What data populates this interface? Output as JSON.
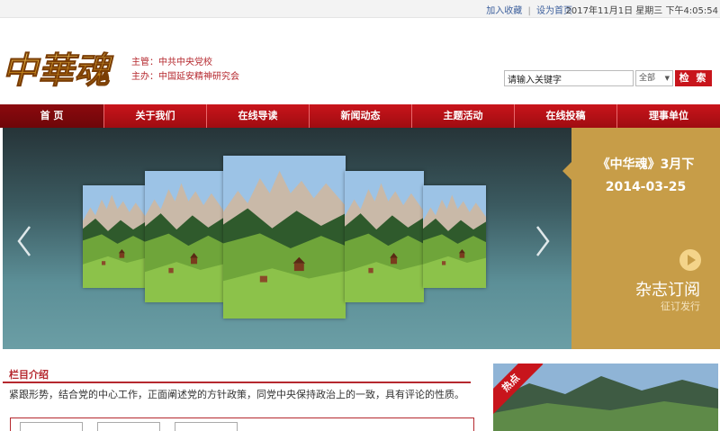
{
  "topbar": {
    "add_favorite": "加入收藏",
    "separator": "|",
    "set_homepage": "设为首页",
    "datetime": "2017年11月1日 星期三 下午4:05:54"
  },
  "header": {
    "logo_text": "中華魂",
    "supervisor": "主管：中共中央党校",
    "organizer": "主办：中国延安精神研究会",
    "search": {
      "value": "请输入关键字",
      "scope": "全部",
      "button": "检 索"
    }
  },
  "nav": {
    "items": [
      {
        "label": "首 页",
        "active": true
      },
      {
        "label": "关于我们"
      },
      {
        "label": "在线导读"
      },
      {
        "label": "新闻动态"
      },
      {
        "label": "主题活动"
      },
      {
        "label": "在线投稿"
      },
      {
        "label": "理事单位"
      }
    ]
  },
  "banner": {
    "issue_title": "《中华魂》3月下",
    "issue_date": "2014-03-25",
    "subscribe": "杂志订阅",
    "subscribe_sub": "征订发行"
  },
  "section": {
    "title": "栏目介绍",
    "text": "紧跟形势，结合党的中心工作，正面阐述党的方针政策，同党中央保持政治上的一致，具有评论的性质。"
  },
  "hot": {
    "ribbon": "热点"
  },
  "colors": {
    "brand_red": "#c8151c",
    "gold": "#c79d48",
    "link_blue": "#3c5f9c"
  }
}
